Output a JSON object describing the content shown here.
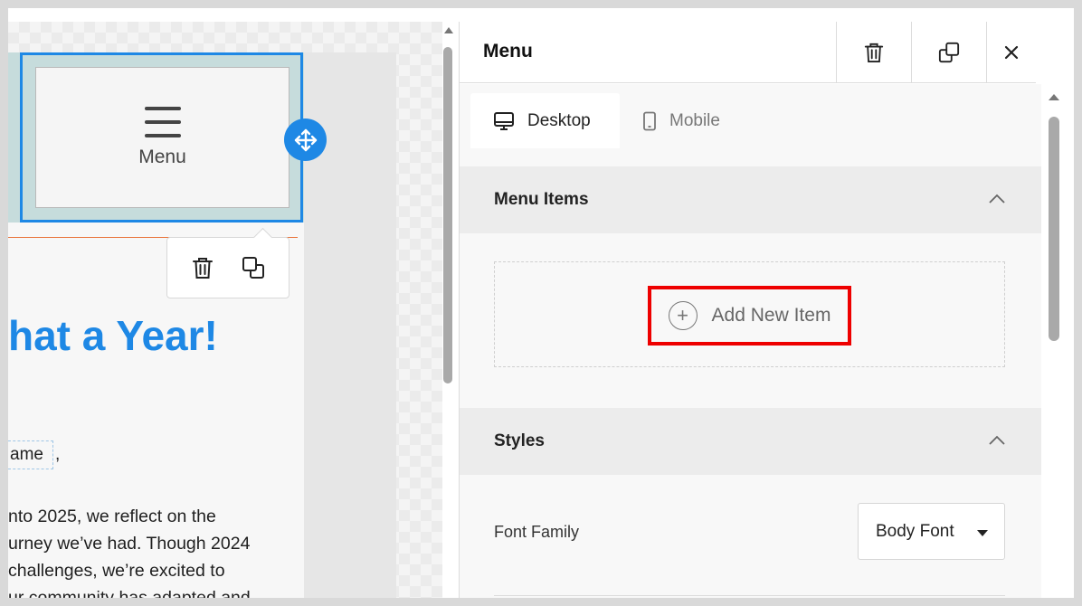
{
  "canvas": {
    "menu_block_label": "Menu",
    "headline": "hat a Year!",
    "name_chip": "ame",
    "comma": ",",
    "paragraph_lines": [
      "nto 2025, we reflect on the",
      "urney we’ve had. Though 2024",
      "challenges, we’re excited to",
      "ur community has adapted and"
    ]
  },
  "panel": {
    "title": "Menu",
    "tabs": [
      {
        "label": "Desktop",
        "icon": "monitor-icon",
        "active": true
      },
      {
        "label": "Mobile",
        "icon": "phone-icon",
        "active": false
      }
    ],
    "menu_items_section": {
      "title": "Menu Items",
      "add_button_label": "Add New Item"
    },
    "styles_section": {
      "title": "Styles",
      "font_family_label": "Font Family",
      "font_family_value": "Body Font"
    }
  },
  "colors": {
    "accent": "#1e88e5",
    "highlight_box": "#ee0000",
    "header_bg": "#c6dcdc"
  }
}
